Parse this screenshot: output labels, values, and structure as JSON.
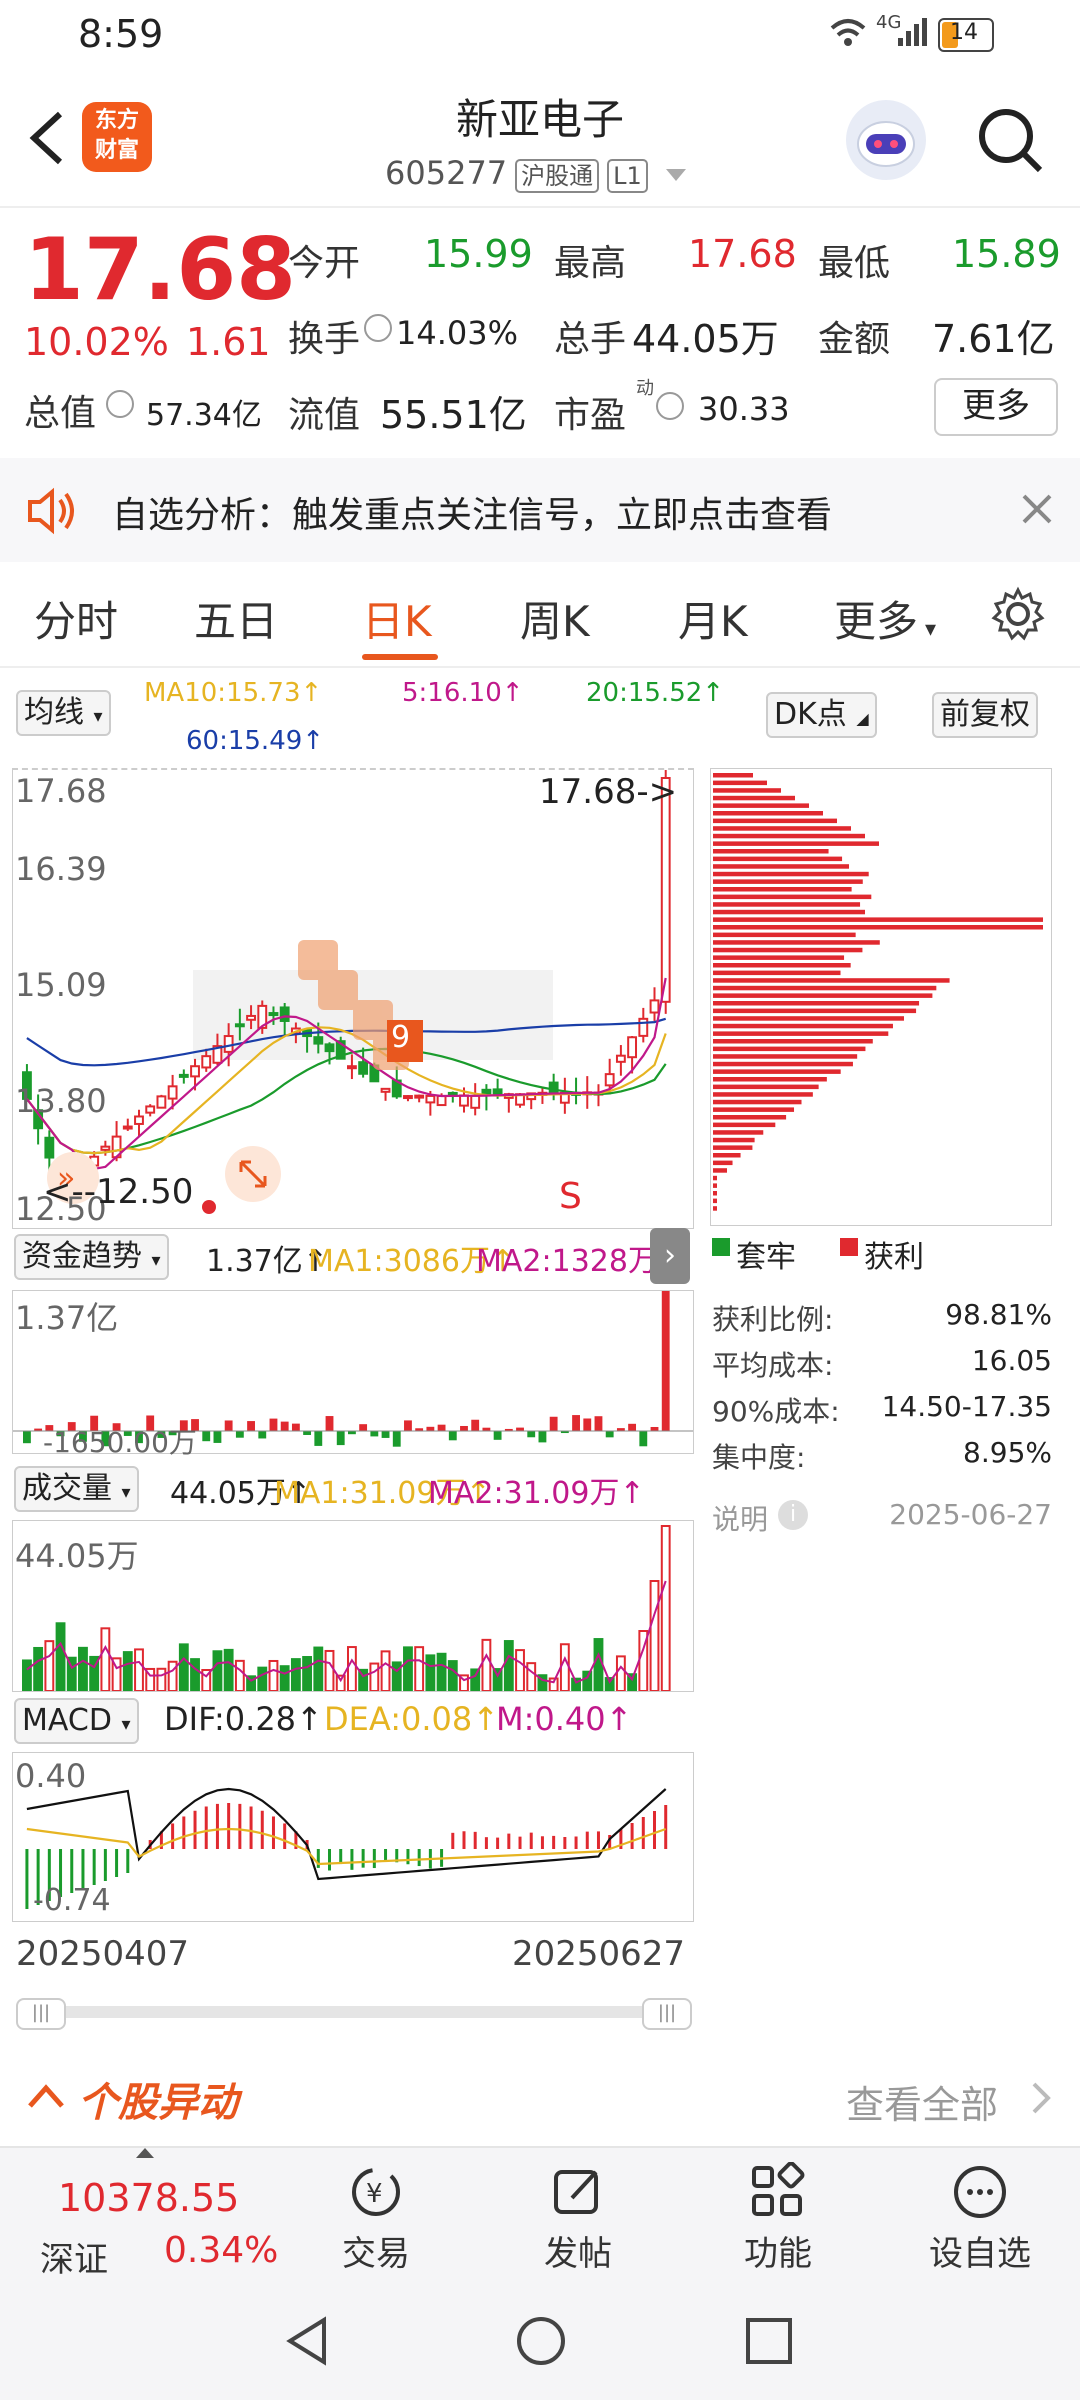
{
  "status_bar": {
    "time": "8:59",
    "network": "4G",
    "battery": "14"
  },
  "header": {
    "logo_line1": "东方",
    "logo_line2": "财富",
    "stock_name": "新亚电子",
    "stock_code": "605277",
    "tag_market": "沪股通",
    "tag_level": "L1"
  },
  "quote": {
    "price": "17.68",
    "change_pct": "10.02%",
    "change_amt": "1.61",
    "open_label": "今开",
    "open": "15.99",
    "high_label": "最高",
    "high": "17.68",
    "low_label": "最低",
    "low": "15.89",
    "turnover_label": "换手",
    "turnover": "14.03%",
    "volume_label": "总手",
    "volume": "44.05万",
    "amount_label": "金额",
    "amount": "7.61亿",
    "mktcap_label": "总值",
    "mktcap": "57.34亿",
    "float_label": "流值",
    "float": "55.51亿",
    "pe_label": "市盈",
    "pe_sup": "动",
    "pe": "30.33",
    "more_label": "更多"
  },
  "banner": {
    "text": "自选分析：触发重点关注信号，立即点击查看"
  },
  "tabs": [
    "分时",
    "五日",
    "日K",
    "周K",
    "月K",
    "更多"
  ],
  "active_tab": "日K",
  "kline": {
    "ma_selector": "均线",
    "ma10": "MA10:15.73↑",
    "ma5": "5:16.10↑",
    "ma20": "20:15.52↑",
    "ma60": "60:15.49↑",
    "dk_label": "DK点",
    "adjust_label": "前复权",
    "y_top": "17.68",
    "y_2": "16.39",
    "y_3": "15.09",
    "y_4": "13.80",
    "y_bottom": "12.50",
    "last_marker": "17.68->",
    "low_marker": "<--12.50",
    "signal_s": "S",
    "seq_label": "9",
    "date_start": "20250407",
    "date_end": "20250627"
  },
  "chip": {
    "legend_trapped": "套牢",
    "legend_profit": "获利",
    "profit_ratio_label": "获利比例:",
    "profit_ratio": "98.81%",
    "avg_cost_label": "平均成本:",
    "avg_cost": "16.05",
    "cost90_label": "90%成本:",
    "cost90": "14.50-17.35",
    "concentration_label": "集中度:",
    "concentration": "8.95%",
    "note_label": "说明",
    "date": "2025-06-27"
  },
  "fund": {
    "selector": "资金趋势",
    "value": "1.37亿↑",
    "ma1": "MA1:3086万↑",
    "ma2": "MA2:1328万↑",
    "y_top": "1.37亿",
    "y_bottom": "-1650.00万"
  },
  "volume": {
    "selector": "成交量",
    "value": "44.05万↑",
    "ma1": "MA1:31.09万↑",
    "ma2": "MA2:31.09万↑",
    "y_top": "44.05万"
  },
  "macd": {
    "selector": "MACD",
    "dif": "DIF:0.28↑",
    "dea": "DEA:0.08↑",
    "m": "M:0.40↑",
    "y_top": "0.40",
    "y_bottom": "-0.74"
  },
  "movement": {
    "title": "个股异动",
    "view_all": "查看全部"
  },
  "bottom_nav": {
    "index_value": "10378.55",
    "index_name": "深证",
    "index_pct": "0.34%",
    "items": [
      "交易",
      "发帖",
      "功能",
      "设自选"
    ]
  },
  "colors": {
    "up": "#e0292f",
    "down": "#1a9b2c",
    "accent": "#e8571e",
    "ma10": "#e6b422",
    "ma5": "#c0188a",
    "ma20": "#1a9b2c",
    "ma60": "#1a3ea8"
  }
}
